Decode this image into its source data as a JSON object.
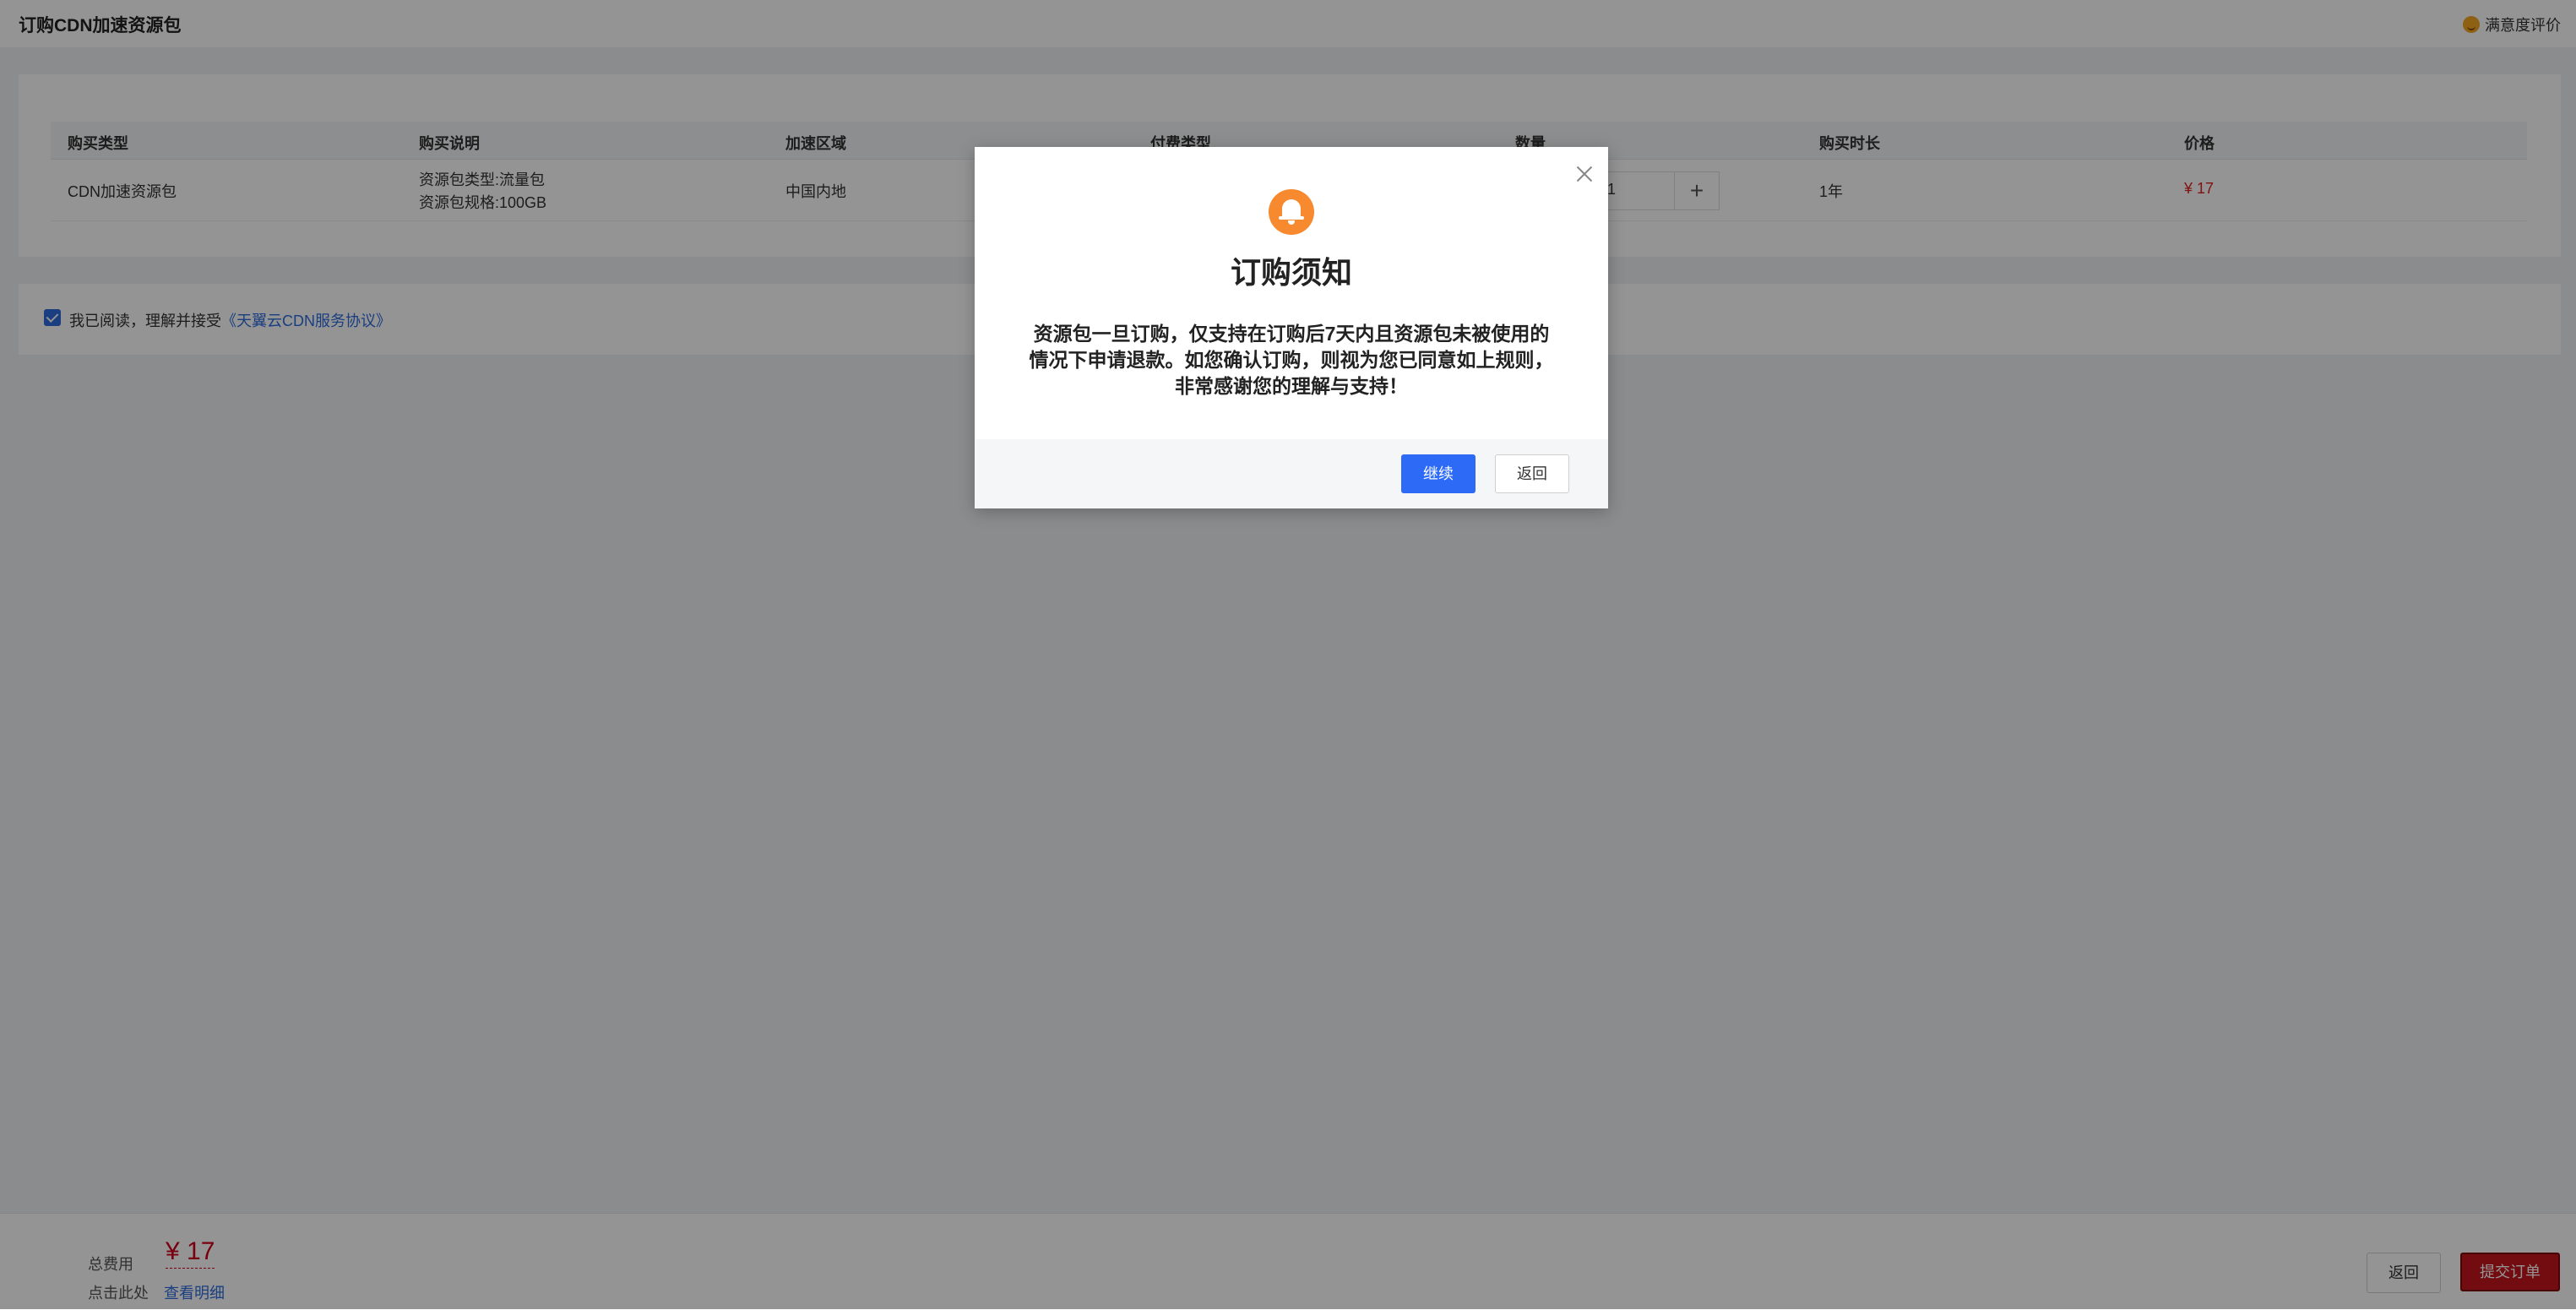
{
  "header": {
    "title": "订购CDN加速资源包",
    "rating_label": "满意度评价"
  },
  "table": {
    "columns": [
      "购买类型",
      "购买说明",
      "加速区域",
      "付费类型",
      "数量",
      "购买时长",
      "价格"
    ],
    "row": {
      "type": "CDN加速资源包",
      "desc_line1": "资源包类型:流量包",
      "desc_line2": "资源包规格:100GB",
      "region": "中国内地",
      "quantity": "1",
      "duration": "1年",
      "price": "¥ 17"
    }
  },
  "agreement": {
    "text": "我已阅读，理解并接受",
    "link": "《天翼云CDN服务协议》",
    "checked": true
  },
  "footer": {
    "fee_label": "总费用",
    "fee_amount": "¥ 17",
    "click_here": "点击此处",
    "view_detail": "查看明细",
    "back_label": "返回",
    "submit_label": "提交订单"
  },
  "modal": {
    "title": "订购须知",
    "body_line1": "资源包一旦订购，仅支持在订购后7天内且资源包未被使用的",
    "body_line2": "情况下申请退款。如您确认订购，则视为您已同意如上规则，",
    "body_line3": "非常感谢您的理解与支持！",
    "continue_label": "继续",
    "return_label": "返回"
  },
  "colors": {
    "accent_blue": "#2d6bf6",
    "price_red": "#e02020",
    "submit_red": "#c4161c",
    "bell_orange": "#f7892f"
  },
  "icons": {
    "bell": "bell-icon",
    "close": "close-icon",
    "rating": "smile-icon",
    "checkbox": "checkbox-checked-icon"
  }
}
